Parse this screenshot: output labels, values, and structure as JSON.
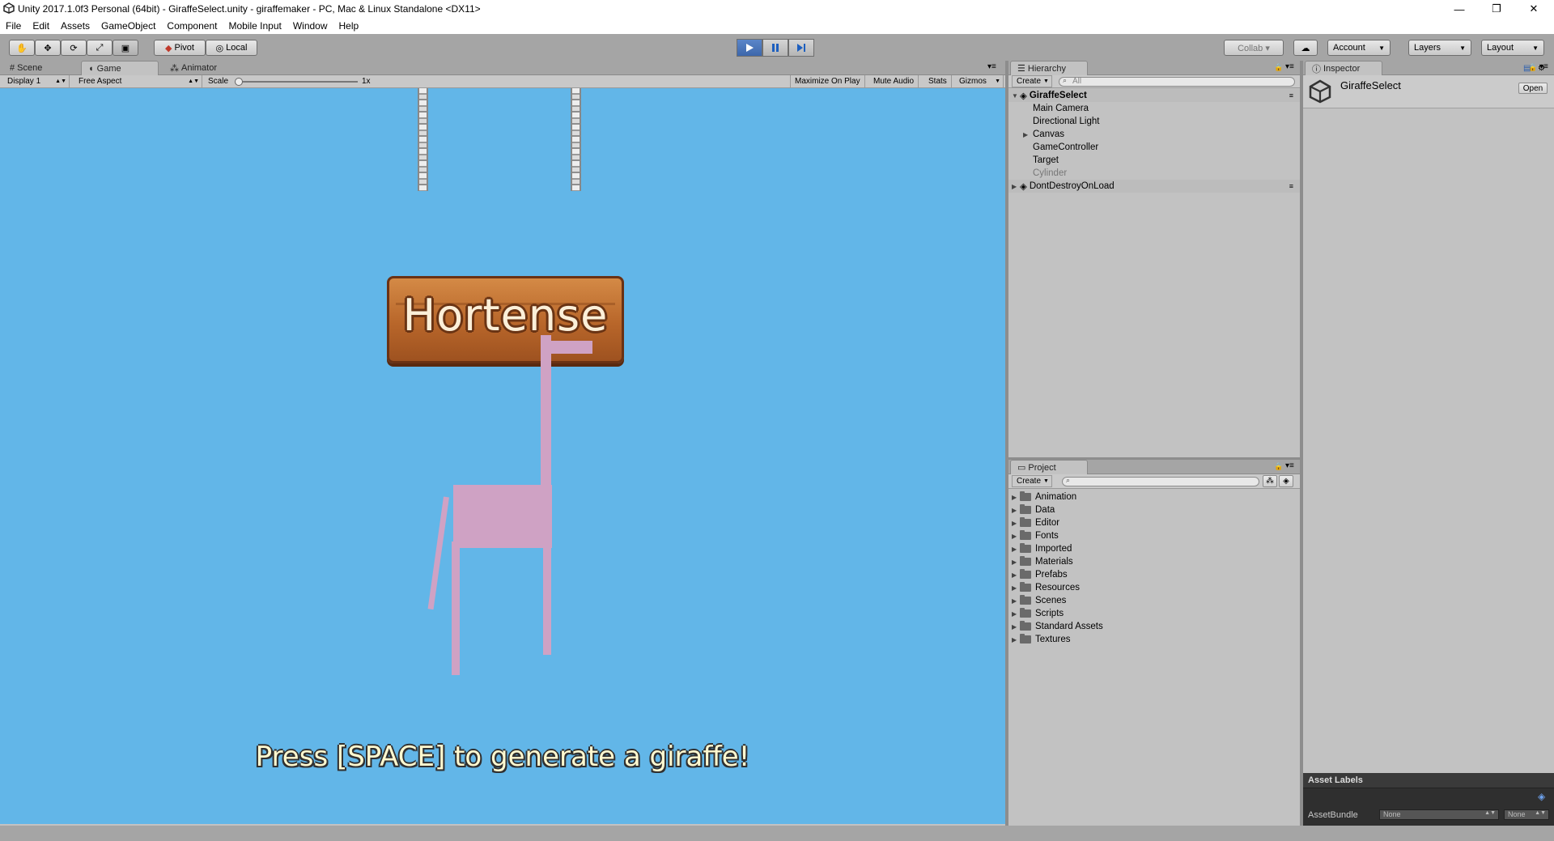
{
  "window": {
    "title": "Unity 2017.1.0f3 Personal (64bit) - GiraffeSelect.unity - giraffemaker - PC, Mac & Linux Standalone <DX11>",
    "minimize": "—",
    "restore": "❐",
    "close": "✕"
  },
  "menu": [
    "File",
    "Edit",
    "Assets",
    "GameObject",
    "Component",
    "Mobile Input",
    "Window",
    "Help"
  ],
  "toolbar": {
    "pivot": "Pivot",
    "local": "Local",
    "collab": "Collab ▾",
    "account": "Account",
    "layers": "Layers",
    "layout": "Layout",
    "play_state": "playing"
  },
  "scene_tabs": {
    "scene": "Scene",
    "game": "Game",
    "animator": "Animator"
  },
  "game_bar": {
    "display": "Display 1",
    "aspect": "Free Aspect",
    "scale_label": "Scale",
    "scale_value": "1x",
    "maximize": "Maximize On Play",
    "mute": "Mute Audio",
    "stats": "Stats",
    "gizmos": "Gizmos"
  },
  "game": {
    "sign_text": "Hortense",
    "prompt": "Press [SPACE] to generate a giraffe!",
    "sky_color": "#62b6e8",
    "giraffe_color": "#cfa2c4"
  },
  "hierarchy": {
    "tab": "Hierarchy",
    "create": "Create",
    "search_placeholder": "All",
    "scene_name": "GiraffeSelect",
    "items": [
      "Main Camera",
      "Directional Light",
      "Canvas",
      "GameController",
      "Target",
      "Cylinder"
    ],
    "dont_destroy": "DontDestroyOnLoad"
  },
  "project": {
    "tab": "Project",
    "create": "Create",
    "folders": [
      "Animation",
      "Data",
      "Editor",
      "Fonts",
      "Imported",
      "Materials",
      "Prefabs",
      "Resources",
      "Scenes",
      "Scripts",
      "Standard Assets",
      "Textures"
    ]
  },
  "inspector": {
    "tab": "Inspector",
    "object_name": "GiraffeSelect",
    "open": "Open",
    "asset_labels": "Asset Labels",
    "asset_bundle": "AssetBundle",
    "bundle_value": "None",
    "variant_value": "None"
  }
}
